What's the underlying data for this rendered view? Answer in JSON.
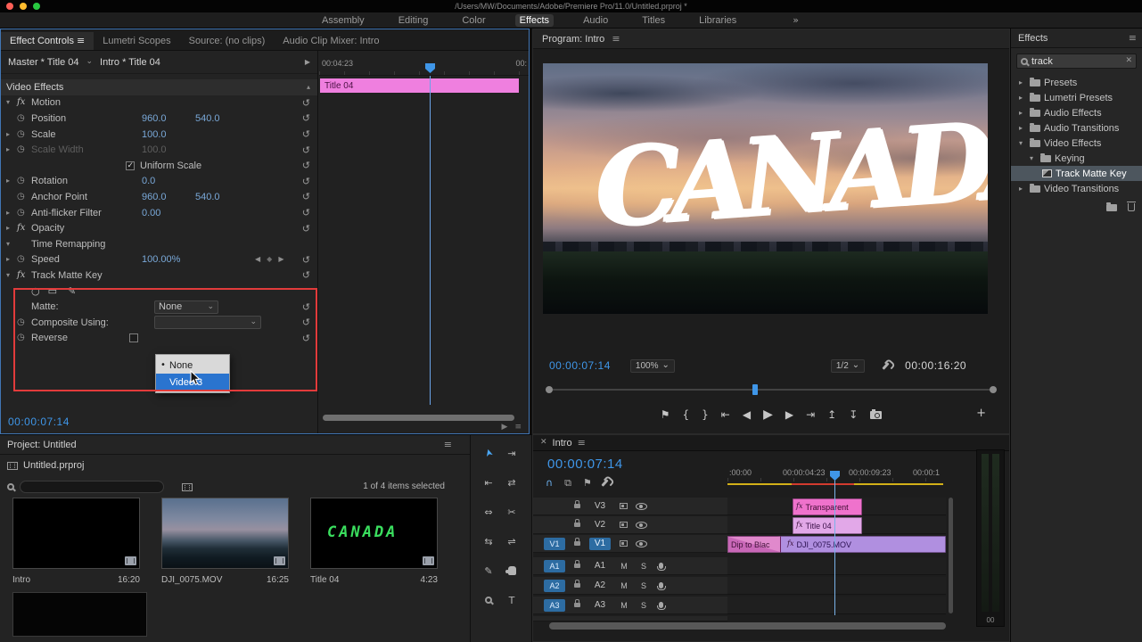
{
  "titlebar": {
    "title": "/Users/MW/Documents/Adobe/Premiere Pro/11.0/Untitled.prproj *"
  },
  "workspace": {
    "tabs": [
      "Assembly",
      "Editing",
      "Color",
      "Effects",
      "Audio",
      "Titles",
      "Libraries"
    ],
    "active_tab": "Effects"
  },
  "effect_controls": {
    "tabs": [
      "Effect Controls",
      "Lumetri Scopes",
      "Source: (no clips)",
      "Audio Clip Mixer: Intro"
    ],
    "master_label": "Master * Title 04",
    "clip_label": "Intro * Title 04",
    "group_video_effects": "Video Effects",
    "motion_label": "Motion",
    "position_label": "Position",
    "position_x": "960.0",
    "position_y": "540.0",
    "scale_label": "Scale",
    "scale_value": "100.0",
    "scale_width_label": "Scale Width",
    "scale_width_value": "100.0",
    "uniform_scale_label": "Uniform Scale",
    "rotation_label": "Rotation",
    "rotation_value": "0.0",
    "anchor_point_label": "Anchor Point",
    "anchor_x": "960.0",
    "anchor_y": "540.0",
    "anti_flicker_label": "Anti-flicker Filter",
    "anti_flicker_value": "0.00",
    "opacity_label": "Opacity",
    "time_remapping_label": "Time Remapping",
    "speed_label": "Speed",
    "speed_value": "100.00%",
    "track_matte_key_label": "Track Matte Key",
    "matte_label": "Matte:",
    "matte_value": "None",
    "composite_using_label": "Composite Using:",
    "reverse_label": "Reverse",
    "dropdown": {
      "option_none": "None",
      "option_video3": "Video 3"
    },
    "timecode": "00:00:07:14",
    "mini_timeline": {
      "ruler_start": "00:04:23",
      "ruler_end": "00:",
      "clip_name": "Title 04"
    }
  },
  "program": {
    "title": "Program: Intro",
    "overlay_text": "CANADA",
    "timecode": "00:00:07:14",
    "zoom_level": "100%",
    "playback_resolution": "1/2",
    "duration": "00:00:16:20"
  },
  "effects_panel": {
    "title": "Effects",
    "search_value": "track",
    "items": [
      {
        "label": "Presets"
      },
      {
        "label": "Lumetri Presets"
      },
      {
        "label": "Audio Effects"
      },
      {
        "label": "Audio Transitions"
      },
      {
        "label": "Video Effects"
      },
      {
        "label": "Keying"
      },
      {
        "label": "Track Matte Key"
      },
      {
        "label": "Video Transitions"
      }
    ]
  },
  "project": {
    "title": "Project: Untitled",
    "file_tab": "Untitled.prproj",
    "selection_status": "1 of 4 items selected",
    "items": [
      {
        "name": "Intro",
        "duration": "16:20"
      },
      {
        "name": "DJI_0075.MOV",
        "duration": "16:25"
      },
      {
        "name": "Title 04",
        "duration": "4:23",
        "thumb_text": "CANADA"
      }
    ]
  },
  "timeline": {
    "tab_label": "Intro",
    "timecode": "00:00:07:14",
    "ruler": [
      ":00:00",
      "00:00:04:23",
      "00:00:09:23",
      "00:00:1"
    ],
    "video_tracks": [
      "V3",
      "V2",
      "V1"
    ],
    "audio_tracks": [
      "A1",
      "A2",
      "A3"
    ],
    "source_badge": "V1",
    "mute_label": "M",
    "solo_label": "S",
    "clips": {
      "transparent": "Transparent",
      "title": "Title 04",
      "dji": "DJI_0075.MOV",
      "transition": "Dip to Blac"
    },
    "meter_label": "00"
  },
  "colors": {
    "accent_blue": "#3f96e8",
    "value_blue": "#79a8d8",
    "clip_pink": "#ef72cc",
    "clip_lavender": "#e2a8e8",
    "clip_purple": "#b08fe0",
    "highlight_red": "#e23b3b",
    "menu_selection": "#2a74cf"
  }
}
